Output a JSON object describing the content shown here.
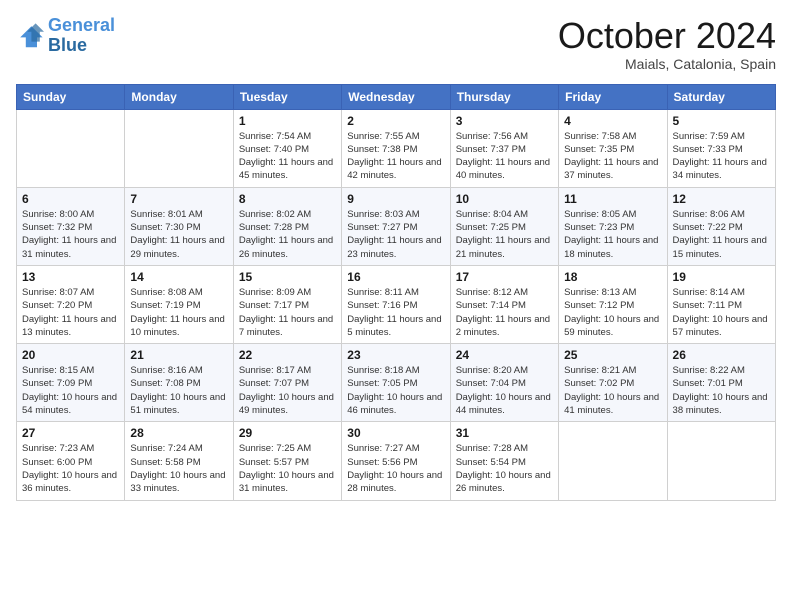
{
  "header": {
    "logo_line1": "General",
    "logo_line2": "Blue",
    "month": "October 2024",
    "location": "Maials, Catalonia, Spain"
  },
  "weekdays": [
    "Sunday",
    "Monday",
    "Tuesday",
    "Wednesday",
    "Thursday",
    "Friday",
    "Saturday"
  ],
  "weeks": [
    [
      {
        "day": "",
        "info": ""
      },
      {
        "day": "",
        "info": ""
      },
      {
        "day": "1",
        "info": "Sunrise: 7:54 AM\nSunset: 7:40 PM\nDaylight: 11 hours and 45 minutes."
      },
      {
        "day": "2",
        "info": "Sunrise: 7:55 AM\nSunset: 7:38 PM\nDaylight: 11 hours and 42 minutes."
      },
      {
        "day": "3",
        "info": "Sunrise: 7:56 AM\nSunset: 7:37 PM\nDaylight: 11 hours and 40 minutes."
      },
      {
        "day": "4",
        "info": "Sunrise: 7:58 AM\nSunset: 7:35 PM\nDaylight: 11 hours and 37 minutes."
      },
      {
        "day": "5",
        "info": "Sunrise: 7:59 AM\nSunset: 7:33 PM\nDaylight: 11 hours and 34 minutes."
      }
    ],
    [
      {
        "day": "6",
        "info": "Sunrise: 8:00 AM\nSunset: 7:32 PM\nDaylight: 11 hours and 31 minutes."
      },
      {
        "day": "7",
        "info": "Sunrise: 8:01 AM\nSunset: 7:30 PM\nDaylight: 11 hours and 29 minutes."
      },
      {
        "day": "8",
        "info": "Sunrise: 8:02 AM\nSunset: 7:28 PM\nDaylight: 11 hours and 26 minutes."
      },
      {
        "day": "9",
        "info": "Sunrise: 8:03 AM\nSunset: 7:27 PM\nDaylight: 11 hours and 23 minutes."
      },
      {
        "day": "10",
        "info": "Sunrise: 8:04 AM\nSunset: 7:25 PM\nDaylight: 11 hours and 21 minutes."
      },
      {
        "day": "11",
        "info": "Sunrise: 8:05 AM\nSunset: 7:23 PM\nDaylight: 11 hours and 18 minutes."
      },
      {
        "day": "12",
        "info": "Sunrise: 8:06 AM\nSunset: 7:22 PM\nDaylight: 11 hours and 15 minutes."
      }
    ],
    [
      {
        "day": "13",
        "info": "Sunrise: 8:07 AM\nSunset: 7:20 PM\nDaylight: 11 hours and 13 minutes."
      },
      {
        "day": "14",
        "info": "Sunrise: 8:08 AM\nSunset: 7:19 PM\nDaylight: 11 hours and 10 minutes."
      },
      {
        "day": "15",
        "info": "Sunrise: 8:09 AM\nSunset: 7:17 PM\nDaylight: 11 hours and 7 minutes."
      },
      {
        "day": "16",
        "info": "Sunrise: 8:11 AM\nSunset: 7:16 PM\nDaylight: 11 hours and 5 minutes."
      },
      {
        "day": "17",
        "info": "Sunrise: 8:12 AM\nSunset: 7:14 PM\nDaylight: 11 hours and 2 minutes."
      },
      {
        "day": "18",
        "info": "Sunrise: 8:13 AM\nSunset: 7:12 PM\nDaylight: 10 hours and 59 minutes."
      },
      {
        "day": "19",
        "info": "Sunrise: 8:14 AM\nSunset: 7:11 PM\nDaylight: 10 hours and 57 minutes."
      }
    ],
    [
      {
        "day": "20",
        "info": "Sunrise: 8:15 AM\nSunset: 7:09 PM\nDaylight: 10 hours and 54 minutes."
      },
      {
        "day": "21",
        "info": "Sunrise: 8:16 AM\nSunset: 7:08 PM\nDaylight: 10 hours and 51 minutes."
      },
      {
        "day": "22",
        "info": "Sunrise: 8:17 AM\nSunset: 7:07 PM\nDaylight: 10 hours and 49 minutes."
      },
      {
        "day": "23",
        "info": "Sunrise: 8:18 AM\nSunset: 7:05 PM\nDaylight: 10 hours and 46 minutes."
      },
      {
        "day": "24",
        "info": "Sunrise: 8:20 AM\nSunset: 7:04 PM\nDaylight: 10 hours and 44 minutes."
      },
      {
        "day": "25",
        "info": "Sunrise: 8:21 AM\nSunset: 7:02 PM\nDaylight: 10 hours and 41 minutes."
      },
      {
        "day": "26",
        "info": "Sunrise: 8:22 AM\nSunset: 7:01 PM\nDaylight: 10 hours and 38 minutes."
      }
    ],
    [
      {
        "day": "27",
        "info": "Sunrise: 7:23 AM\nSunset: 6:00 PM\nDaylight: 10 hours and 36 minutes."
      },
      {
        "day": "28",
        "info": "Sunrise: 7:24 AM\nSunset: 5:58 PM\nDaylight: 10 hours and 33 minutes."
      },
      {
        "day": "29",
        "info": "Sunrise: 7:25 AM\nSunset: 5:57 PM\nDaylight: 10 hours and 31 minutes."
      },
      {
        "day": "30",
        "info": "Sunrise: 7:27 AM\nSunset: 5:56 PM\nDaylight: 10 hours and 28 minutes."
      },
      {
        "day": "31",
        "info": "Sunrise: 7:28 AM\nSunset: 5:54 PM\nDaylight: 10 hours and 26 minutes."
      },
      {
        "day": "",
        "info": ""
      },
      {
        "day": "",
        "info": ""
      }
    ]
  ]
}
